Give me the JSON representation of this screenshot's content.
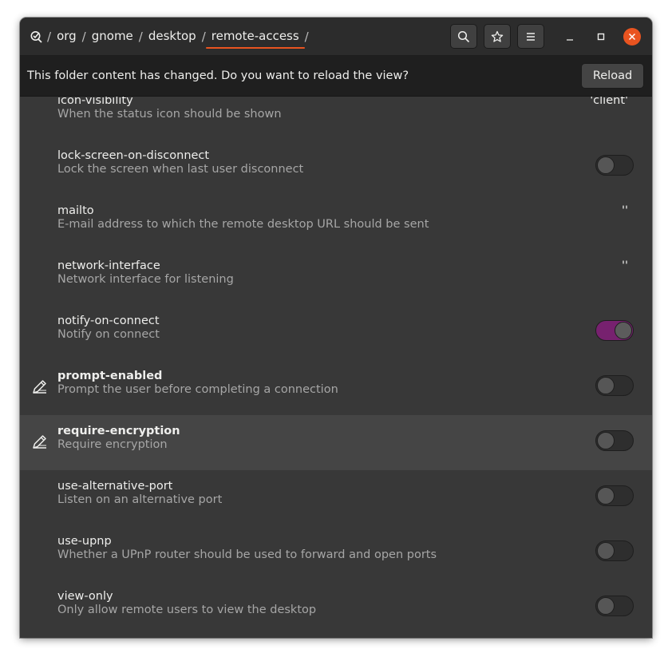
{
  "header": {
    "path": [
      "org",
      "gnome",
      "desktop",
      "remote-access"
    ],
    "separator": "/",
    "search_icon": "search-icon",
    "bookmark_icon": "star-icon",
    "menu_icon": "hamburger-menu-icon"
  },
  "infobar": {
    "message": "This folder content has changed. Do you want to reload the view?",
    "reload_label": "Reload"
  },
  "colors": {
    "accent": "#e95420",
    "switch_on": "#77216f"
  },
  "keys": [
    {
      "name": "icon-visibility",
      "description": "When the status icon should be shown",
      "value": "'client'",
      "modified": false
    },
    {
      "name": "lock-screen-on-disconnect",
      "description": "Lock the screen when last user disconnect",
      "switch": false,
      "modified": false
    },
    {
      "name": "mailto",
      "description": "E-mail address to which the remote desktop URL should be sent",
      "value": "''",
      "modified": false
    },
    {
      "name": "network-interface",
      "description": "Network interface for listening",
      "value": "''",
      "modified": false
    },
    {
      "name": "notify-on-connect",
      "description": "Notify on connect",
      "switch": true,
      "modified": false
    },
    {
      "name": "prompt-enabled",
      "description": "Prompt the user before completing a connection",
      "switch": false,
      "modified": true
    },
    {
      "name": "require-encryption",
      "description": "Require encryption",
      "switch": false,
      "modified": true,
      "selected": true
    },
    {
      "name": "use-alternative-port",
      "description": "Listen on an alternative port",
      "switch": false,
      "modified": false
    },
    {
      "name": "use-upnp",
      "description": "Whether a UPnP router should be used to forward and open ports",
      "switch": false,
      "modified": false
    },
    {
      "name": "view-only",
      "description": "Only allow remote users to view the desktop",
      "switch": false,
      "modified": false
    }
  ]
}
